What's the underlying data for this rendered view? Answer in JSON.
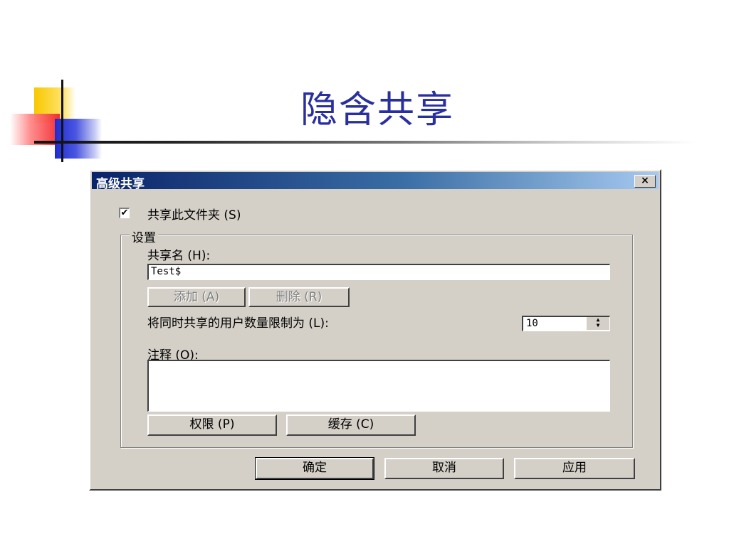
{
  "slide": {
    "title": "隐含共享"
  },
  "dialog": {
    "title": "高级共享",
    "close_label": "×",
    "share_checkbox": {
      "checked": true,
      "mark": "✔",
      "label": "共享此文件夹 (S)"
    },
    "group_label": "设置",
    "share_name_label": "共享名 (H):",
    "share_name_value": "Test$",
    "add_button": "添加 (A)",
    "remove_button": "删除 (R)",
    "user_limit_label": "将同时共享的用户数量限制为 (L):",
    "user_limit_value": "10",
    "comment_label": "注释 (O):",
    "comment_value": "",
    "permissions_button": "权限 (P)",
    "caching_button": "缓存 (C)",
    "ok_button": "确定",
    "cancel_button": "取消",
    "apply_button": "应用"
  }
}
